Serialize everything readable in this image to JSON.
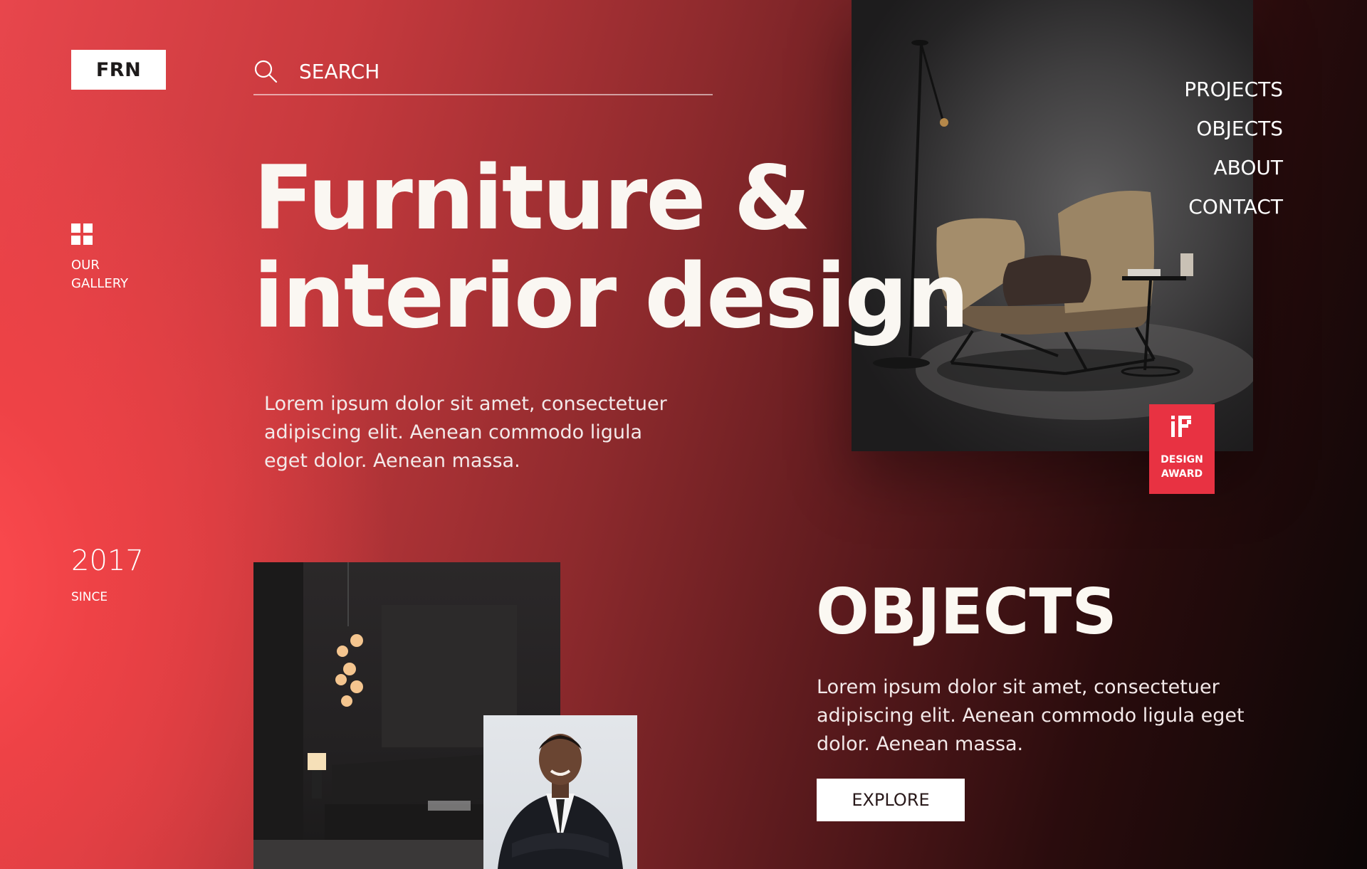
{
  "brand": {
    "logo": "FRN"
  },
  "search": {
    "placeholder": "SEARCH",
    "value": ""
  },
  "sidebar": {
    "gallery_label": "OUR GALLERY",
    "since_year": "2017",
    "since_label": "SINCE"
  },
  "nav": {
    "items": [
      {
        "label": "PROJECTS"
      },
      {
        "label": "OBJECTS"
      },
      {
        "label": "ABOUT"
      },
      {
        "label": "CONTACT"
      }
    ]
  },
  "hero": {
    "title_line1": "Furniture &",
    "title_line2": "interior design",
    "description": "Lorem ipsum dolor sit amet, consectetuer adipiscing elit. Aenean commodo ligula eget dolor. Aenean massa."
  },
  "award": {
    "logo_text": "iF",
    "line1": "DESIGN",
    "line2": "AWARD"
  },
  "objects": {
    "title": "OBJECTS",
    "description": "Lorem ipsum dolor sit amet, consectetuer adipiscing elit. Aenean commodo ligula eget dolor. Aenean massa.",
    "button_label": "EXPLORE"
  },
  "colors": {
    "accent": "#e83242",
    "background_start": "#ff4c50",
    "background_end": "#0b0606",
    "text": "#ffffff"
  },
  "icons": {
    "search": "search-icon",
    "gallery": "grid-icon"
  }
}
